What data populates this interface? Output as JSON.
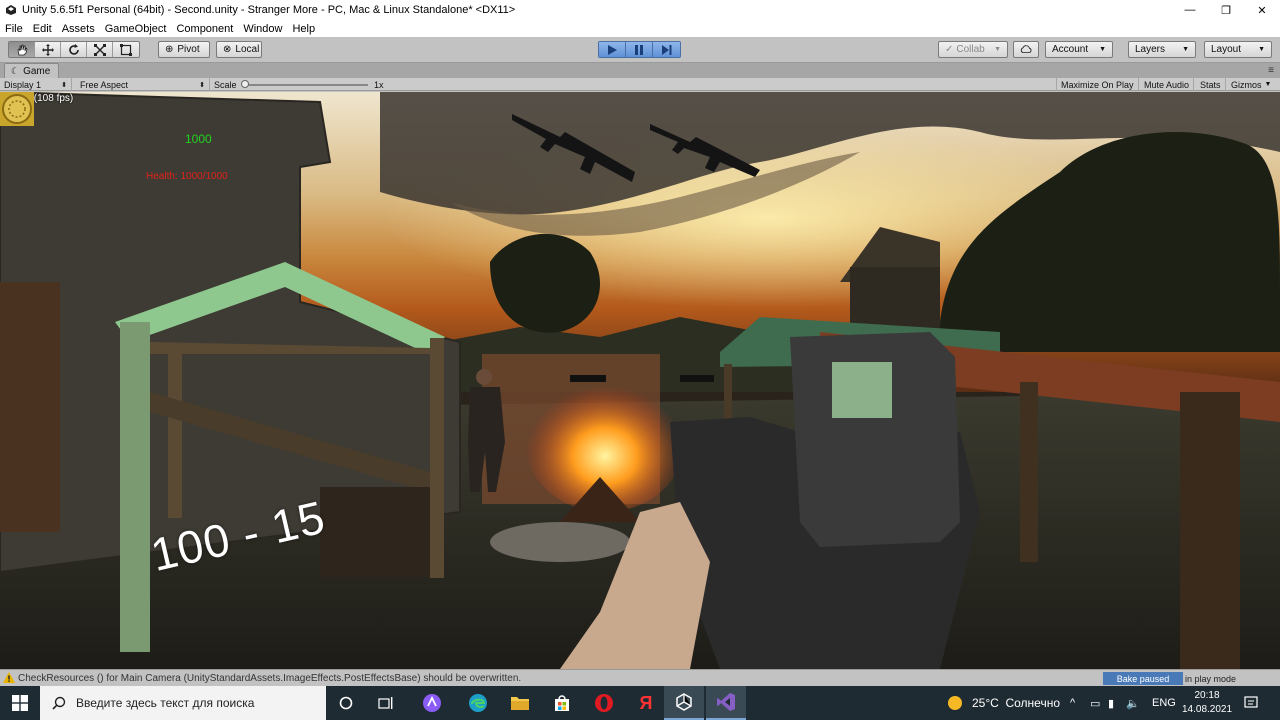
{
  "window": {
    "title": "Unity 5.6.5f1 Personal (64bit) - Second.unity - Stranger More - PC, Mac & Linux Standalone* <DX11>",
    "minimize": "—",
    "maximize": "❐",
    "close": "✕"
  },
  "menu": [
    "File",
    "Edit",
    "Assets",
    "GameObject",
    "Component",
    "Window",
    "Help"
  ],
  "toolbar": {
    "tools": [
      "hand-tool",
      "move-tool",
      "rotate-tool",
      "scale-tool",
      "rect-tool"
    ],
    "pivot_label": "Pivot",
    "local_label": "Local",
    "collab_label": "Collab",
    "account_label": "Account",
    "layers_label": "Layers",
    "layout_label": "Layout"
  },
  "game_tab": {
    "label": "Game",
    "display": "Display 1",
    "aspect": "Free Aspect",
    "scale_label": "Scale",
    "scale_value": "1x",
    "maximize_on_play": "Maximize On Play",
    "mute_audio": "Mute Audio",
    "stats": "Stats",
    "gizmos": "Gizmos"
  },
  "hud": {
    "fps": "9.3 ms (108 fps)",
    "coins": "1000",
    "health": "Health: 1000/1000",
    "ammo": "100 - 15"
  },
  "status": {
    "message": "CheckResources () for Main Camera (UnityStandardAssets.ImageEffects.PostEffectsBase) should be overwritten.",
    "bake_highlight": "Bake paused",
    "bake_rest": "in play mode"
  },
  "taskbar": {
    "search_placeholder": "Введите здесь текст для поиска",
    "weather": "25°C  Солнечно",
    "lang": "ENG",
    "time": "20:18",
    "date": "14.08.2021"
  },
  "colors": {
    "play_accent": "#5f91d6",
    "coin_text": "#22d21e",
    "health_text": "#e0221a",
    "taskbar_bg": "#1f2b33"
  }
}
